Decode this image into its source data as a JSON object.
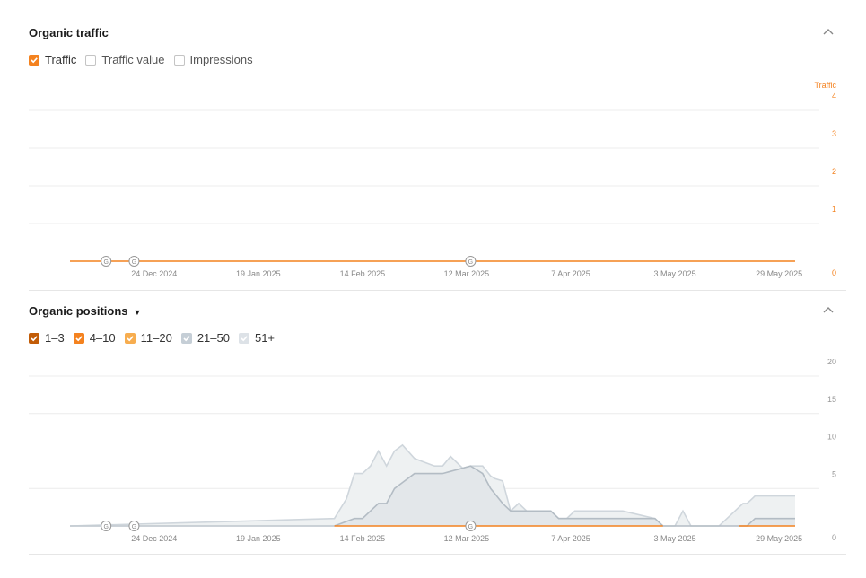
{
  "colors": {
    "accent": "#f4821f",
    "pos_1_3": "#c25c07",
    "pos_4_10": "#f4821f",
    "pos_11_20": "#f7ad4f",
    "pos_21_50": "#c5ced6",
    "pos_51_plus": "#dde2e7",
    "grid": "#ececec"
  },
  "traffic_section": {
    "title": "Organic traffic",
    "collapse_icon": "chevron-up-icon",
    "metrics": [
      {
        "label": "Traffic",
        "checked": true,
        "color": "#f4821f"
      },
      {
        "label": "Traffic value",
        "checked": false
      },
      {
        "label": "Impressions",
        "checked": false
      }
    ]
  },
  "positions_section": {
    "title": "Organic positions",
    "dropdown_icon": "caret-down-icon",
    "collapse_icon": "chevron-up-icon",
    "ranges": [
      {
        "label": "1–3",
        "checked": true,
        "color": "#c25c07"
      },
      {
        "label": "4–10",
        "checked": true,
        "color": "#f4821f"
      },
      {
        "label": "11–20",
        "checked": true,
        "color": "#f7ad4f"
      },
      {
        "label": "21–50",
        "checked": true,
        "color": "#c5ced6"
      },
      {
        "label": "51+",
        "checked": true,
        "color": "#dde2e7"
      }
    ]
  },
  "chart_data": [
    {
      "type": "line",
      "ylabel": "Traffic",
      "ylim": [
        0,
        4
      ],
      "yticks": [
        "0",
        "1",
        "2",
        "3",
        "4"
      ],
      "x_tick_labels": [
        "24 Dec 2024",
        "19 Jan 2025",
        "14 Feb 2025",
        "12 Mar 2025",
        "7 Apr 2025",
        "3 May 2025",
        "29 May 2025"
      ],
      "x_range": [
        "2024-12-03",
        "2025-06-02"
      ],
      "grid": true,
      "google_update_markers": [
        "2024-12-12",
        "2024-12-19",
        "2025-03-13"
      ],
      "marker_label": "G",
      "series": [
        {
          "name": "Traffic",
          "color": "#f4821f",
          "x": [
            "2024-12-03",
            "2025-06-02"
          ],
          "y": [
            0,
            0
          ]
        }
      ]
    },
    {
      "type": "area",
      "ylim": [
        0,
        20
      ],
      "yticks": [
        "0",
        "5",
        "10",
        "15",
        "20"
      ],
      "x_tick_labels": [
        "24 Dec 2024",
        "19 Jan 2025",
        "14 Feb 2025",
        "12 Mar 2025",
        "7 Apr 2025",
        "3 May 2025",
        "29 May 2025"
      ],
      "x_range": [
        "2024-12-03",
        "2025-06-02"
      ],
      "grid": true,
      "stacked": true,
      "google_update_markers": [
        "2024-12-12",
        "2024-12-19",
        "2025-03-13"
      ],
      "marker_label": "G",
      "series": [
        {
          "name": "1–3",
          "color": "#c25c07",
          "x": [
            "2024-12-03",
            "2025-06-02"
          ],
          "y": [
            0,
            0
          ]
        },
        {
          "name": "4–10",
          "color": "#f4821f",
          "x": [
            "2024-12-03",
            "2025-06-02"
          ],
          "y": [
            0,
            0
          ]
        },
        {
          "name": "11–20",
          "color": "#f7ad4f",
          "x": [
            "2024-12-03",
            "2025-06-02"
          ],
          "y": [
            0,
            0
          ]
        },
        {
          "name": "21–50",
          "color": "#c5ced6",
          "x": [
            "2024-12-03",
            "2025-02-07",
            "2025-02-12",
            "2025-02-14",
            "2025-02-18",
            "2025-02-20",
            "2025-02-22",
            "2025-02-27",
            "2025-03-01",
            "2025-03-06",
            "2025-03-13",
            "2025-03-16",
            "2025-03-18",
            "2025-03-21",
            "2025-03-23",
            "2025-03-26",
            "2025-04-02",
            "2025-04-04",
            "2025-04-08",
            "2025-04-10",
            "2025-04-14",
            "2025-04-28",
            "2025-04-30",
            "2025-05-19",
            "2025-05-21",
            "2025-05-23",
            "2025-06-02"
          ],
          "y": [
            0,
            0,
            1,
            1,
            3,
            3,
            5,
            7,
            7,
            7,
            8,
            7,
            5,
            3,
            2,
            2,
            2,
            1,
            1,
            1,
            1,
            1,
            0,
            0,
            0,
            1,
            1
          ]
        },
        {
          "name": "51+",
          "color": "#dde2e7",
          "x": [
            "2024-12-03",
            "2025-02-07",
            "2025-02-10",
            "2025-02-12",
            "2025-02-14",
            "2025-02-16",
            "2025-02-18",
            "2025-02-20",
            "2025-02-22",
            "2025-02-24",
            "2025-02-27",
            "2025-03-04",
            "2025-03-06",
            "2025-03-08",
            "2025-03-11",
            "2025-03-13",
            "2025-03-16",
            "2025-03-19",
            "2025-03-21",
            "2025-03-23",
            "2025-03-25",
            "2025-03-27",
            "2025-03-30",
            "2025-04-01",
            "2025-04-04",
            "2025-04-06",
            "2025-04-08",
            "2025-04-10",
            "2025-04-14",
            "2025-04-20",
            "2025-04-28",
            "2025-04-30",
            "2025-05-03",
            "2025-05-05",
            "2025-05-07",
            "2025-05-09",
            "2025-05-11",
            "2025-05-14",
            "2025-05-16",
            "2025-05-18",
            "2025-05-20",
            "2025-05-22",
            "2025-05-24",
            "2025-05-26",
            "2025-05-28",
            "2025-05-30",
            "2025-06-02"
          ],
          "y": [
            0,
            1,
            3,
            6,
            6,
            6,
            7,
            5,
            5,
            5,
            2,
            1,
            1,
            2,
            0,
            0,
            1,
            2,
            3,
            0,
            1,
            0,
            0,
            0,
            0,
            0,
            1,
            1,
            1,
            1,
            0,
            0,
            0,
            2,
            0,
            0,
            0,
            0,
            1,
            2,
            3,
            3,
            3,
            3,
            3,
            3,
            3
          ]
        }
      ]
    }
  ]
}
